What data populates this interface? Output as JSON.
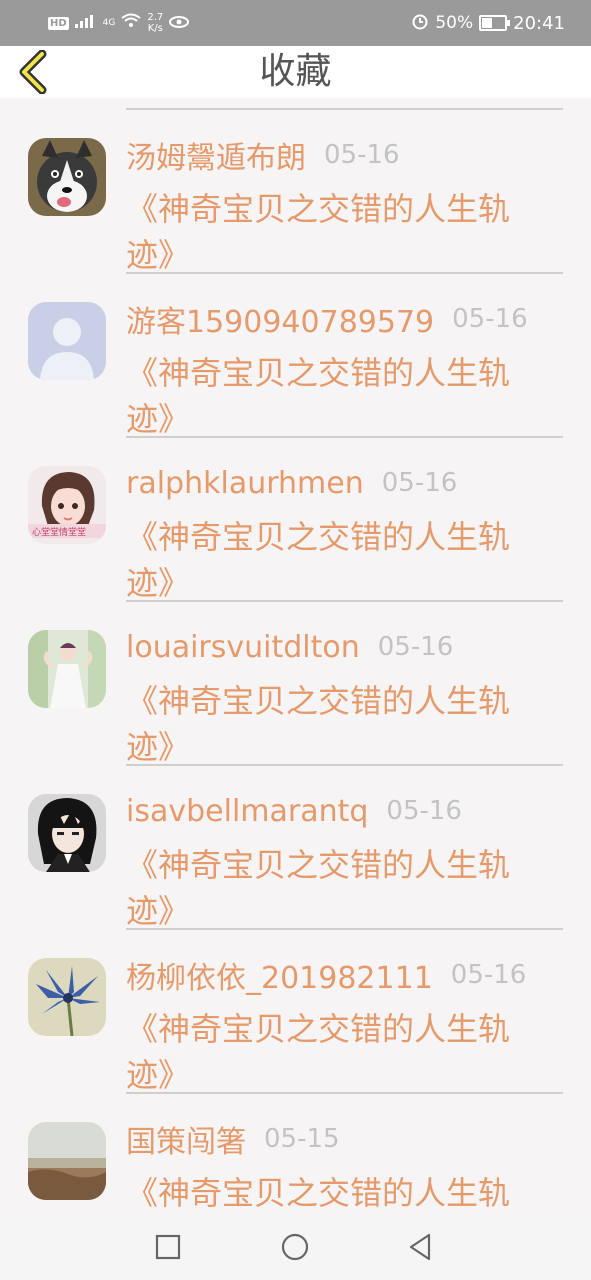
{
  "status_bar": {
    "hd": "HD",
    "network": "4G",
    "speed_value": "2.7",
    "speed_unit": "K/s",
    "battery": "50%",
    "time": "20:41"
  },
  "header": {
    "title": "收藏",
    "back_icon": "chevron-left-icon"
  },
  "items": [
    {
      "username": "汤姆鬶遁布朗",
      "date": "05-16",
      "title": "《神奇宝贝之交错的人生轨迹》",
      "avatar": "husky-avatar"
    },
    {
      "username": "游客1590940789579",
      "date": "05-16",
      "title": "《神奇宝贝之交错的人生轨迹》",
      "avatar": "default-avatar"
    },
    {
      "username": "ralphklaurhmen",
      "date": "05-16",
      "title": "《神奇宝贝之交错的人生轨迹》",
      "avatar": "girl-avatar"
    },
    {
      "username": "louairsvuitdlton",
      "date": "05-16",
      "title": "《神奇宝贝之交错的人生轨迹》",
      "avatar": "bride-avatar"
    },
    {
      "username": "isavbellmarantq",
      "date": "05-16",
      "title": "《神奇宝贝之交错的人生轨迹》",
      "avatar": "anime-avatar"
    },
    {
      "username": "杨柳依依_201982111",
      "date": "05-16",
      "title": "《神奇宝贝之交错的人生轨迹》",
      "avatar": "flower-avatar"
    },
    {
      "username": "国策闯箸",
      "date": "05-15",
      "title": "《神奇宝贝之交错的人生轨迹》",
      "avatar": "landscape-avatar"
    }
  ],
  "nav": {
    "recents": "square-icon",
    "home": "circle-icon",
    "back": "triangle-back-icon"
  }
}
